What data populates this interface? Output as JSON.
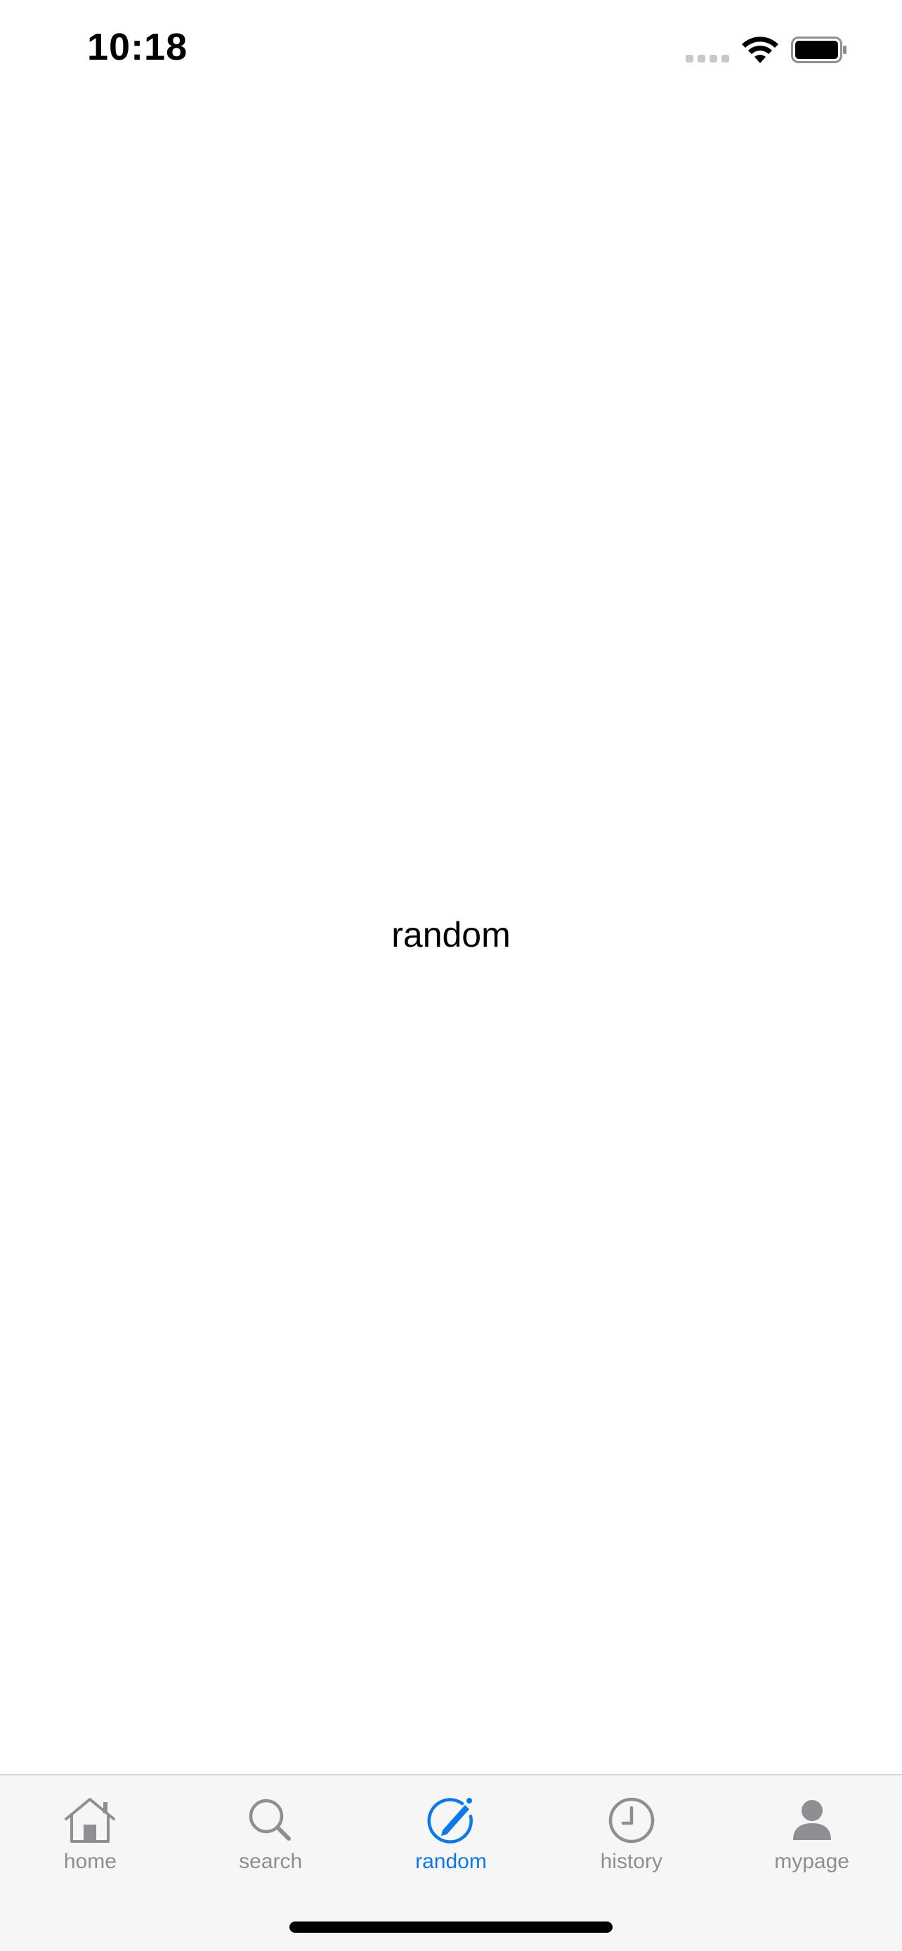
{
  "status_bar": {
    "time": "10:18"
  },
  "main": {
    "label": "random"
  },
  "tab_bar": {
    "active_color": "#0a7aea",
    "inactive_color": "#8e8e93",
    "tabs": [
      {
        "label": "home",
        "icon": "house-icon",
        "active": false
      },
      {
        "label": "search",
        "icon": "magnifying-glass-icon",
        "active": false
      },
      {
        "label": "random",
        "icon": "pencil-circle-icon",
        "active": true
      },
      {
        "label": "history",
        "icon": "clock-icon",
        "active": false
      },
      {
        "label": "mypage",
        "icon": "person-icon",
        "active": false
      }
    ]
  }
}
